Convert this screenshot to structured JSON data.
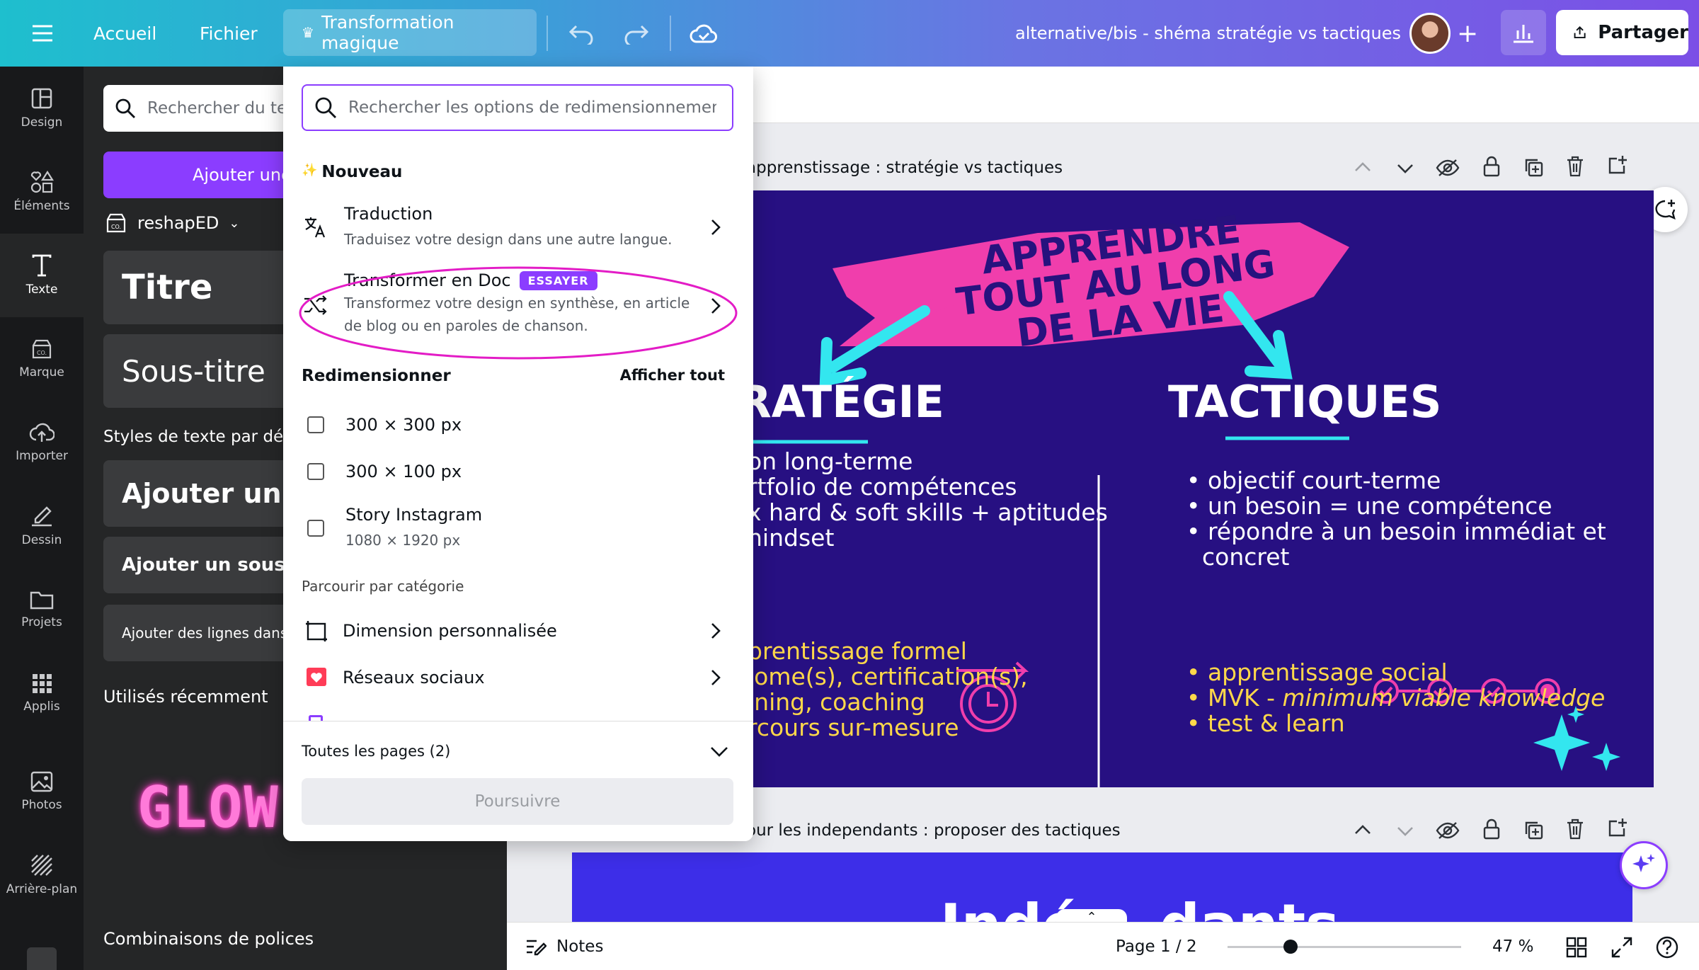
{
  "topbar": {
    "home": "Accueil",
    "file": "Fichier",
    "magic": "Transformation magique",
    "doc_title": "alternative/bis - shéma stratégie vs tactiques",
    "share": "Partager"
  },
  "rail": [
    {
      "label": "Design",
      "icon": "layout-icon"
    },
    {
      "label": "Éléments",
      "icon": "shapes-icon"
    },
    {
      "label": "Texte",
      "icon": "text-icon"
    },
    {
      "label": "Marque",
      "icon": "brand-icon"
    },
    {
      "label": "Importer",
      "icon": "cloud-upload-icon"
    },
    {
      "label": "Dessin",
      "icon": "pen-icon"
    },
    {
      "label": "Projets",
      "icon": "folder-icon"
    },
    {
      "label": "Applis",
      "icon": "grid-icon"
    },
    {
      "label": "Photos",
      "icon": "image-icon"
    },
    {
      "label": "Arrière-plan",
      "icon": "pattern-icon"
    }
  ],
  "panel": {
    "search_placeholder": "Rechercher du te",
    "add_text_button": "Ajouter une",
    "brand_name": "reshapED",
    "title_style": "Titre",
    "subtitle_style": "Sous-titre",
    "default_styles_heading": "Styles de texte par déf",
    "add_title": "Ajouter un t",
    "add_subtitle": "Ajouter un sous-ti",
    "add_body": "Ajouter des lignes dans l",
    "recent_heading": "Utilisés récemment",
    "glow": "GLOW",
    "font_combos": "Combinaisons de polices"
  },
  "popup": {
    "search_placeholder": "Rechercher les options de redimensionnement",
    "new_heading": "Nouveau",
    "new_heading_icon": "✨",
    "translate_title": "Traduction",
    "translate_sub": "Traduisez votre design dans une autre langue.",
    "doc_title": "Transformer en Doc",
    "doc_badge": "ESSAYER",
    "doc_sub1": "Transformez votre design en synthèse, en article",
    "doc_sub2": "de blog ou en paroles de chanson.",
    "resize_heading": "Redimensionner",
    "show_all": "Afficher tout",
    "sizes": [
      {
        "label": "300 × 300 px",
        "sub": ""
      },
      {
        "label": "300 × 100 px",
        "sub": ""
      },
      {
        "label": "Story Instagram",
        "sub": "1080 × 1920 px"
      }
    ],
    "browse_heading": "Parcourir par catégorie",
    "categories": [
      "Dimension personnalisée",
      "Réseaux sociaux"
    ],
    "pages_label": "Toutes les pages (2)",
    "continue": "Poursuivre"
  },
  "canvas": {
    "page1_title": "apprenstissage : stratégie vs tactiques",
    "page2_title": "our les independants : proposer des tactiques",
    "slide": {
      "banner": [
        "APPRENDRE",
        "TOUT AU LONG",
        "DE LA VIE"
      ],
      "left_heading": "RATÉGIE",
      "left_items": [
        "on long-terme",
        "rtfolio de compétences",
        "x hard & soft skills + aptitudes",
        "nindset"
      ],
      "left_yellow": [
        "prentissage formel",
        "lome(s), certification(s),",
        "ining, coaching",
        "rcours sur-mesure"
      ],
      "right_heading": "TACTIQUES",
      "right_items": [
        "• objectif court-terme",
        "• un besoin = une compétence",
        "• répondre à un besoin immédiat et",
        "concret"
      ],
      "right_yellow": [
        "• apprentissage social",
        "• test & learn"
      ],
      "mvk_prefix": "• MVK - ",
      "mvk_italic": "minimum viable knowledge"
    },
    "slide2_text": "Indé    dants"
  },
  "bottombar": {
    "notes": "Notes",
    "page": "Page 1 / 2",
    "zoom": "47 %",
    "zoom_level": 0.47
  },
  "colors": {
    "accent": "#8b3dff",
    "slide_bg": "#271082",
    "pink": "#f03eac",
    "cyan": "#33e6ef",
    "yellow": "#ffd84a"
  }
}
